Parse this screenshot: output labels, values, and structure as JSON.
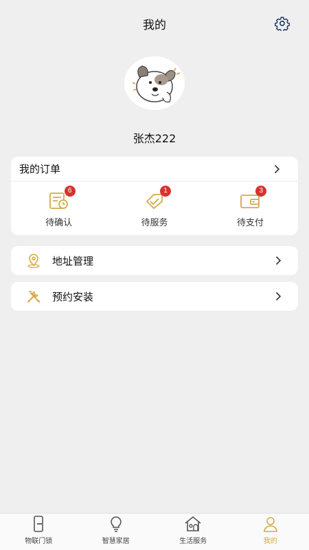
{
  "header": {
    "title": "我的",
    "settings_icon": "gear-icon"
  },
  "profile": {
    "username": "张杰222",
    "avatar_icon": "cartoon-dog-avatar"
  },
  "orders": {
    "title": "我的订单",
    "items": [
      {
        "label": "待确认",
        "badge": "6",
        "icon": "pending-confirm-icon"
      },
      {
        "label": "待服务",
        "badge": "1",
        "icon": "pending-service-icon"
      },
      {
        "label": "待支付",
        "badge": "3",
        "icon": "wallet-icon"
      }
    ]
  },
  "menu": [
    {
      "label": "地址管理",
      "icon": "location-pin-icon"
    },
    {
      "label": "预约安装",
      "icon": "tools-icon"
    }
  ],
  "tabbar": {
    "items": [
      {
        "label": "物联门锁",
        "icon": "door-lock-icon"
      },
      {
        "label": "智慧家居",
        "icon": "lightbulb-icon"
      },
      {
        "label": "生活服务",
        "icon": "house-icon"
      },
      {
        "label": "我的",
        "icon": "user-icon"
      }
    ],
    "active_index": 3
  },
  "colors": {
    "accent": "#d4a94a",
    "badge": "#d8322e",
    "background": "#efefef"
  }
}
